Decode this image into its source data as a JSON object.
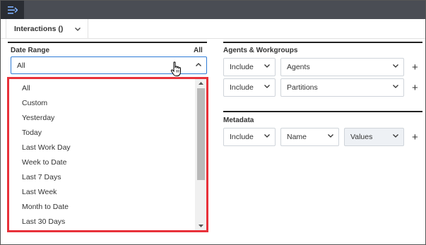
{
  "app": {
    "menu_icon": "collapse-menu-icon"
  },
  "tab": {
    "label": "Interactions ()",
    "icon": "chevron-down-icon"
  },
  "date_range": {
    "label": "Date Range",
    "summary": "All",
    "selected": "All",
    "options": [
      "All",
      "Custom",
      "Yesterday",
      "Today",
      "Last Work Day",
      "Week to Date",
      "Last 7 Days",
      "Last Week",
      "Month to Date",
      "Last 30 Days"
    ]
  },
  "agents_workgroups": {
    "label": "Agents & Workgroups",
    "rows": [
      {
        "mode": "Include",
        "value": "Agents"
      },
      {
        "mode": "Include",
        "value": "Partitions"
      }
    ]
  },
  "metadata": {
    "label": "Metadata",
    "mode": "Include",
    "name": "Name",
    "values": "Values"
  },
  "add_symbol": "+",
  "colors": {
    "topbar": "#4a4d54",
    "menu_button": "#2a2d33",
    "accent": "#2e7bd6",
    "highlight_border": "#e8313a"
  }
}
